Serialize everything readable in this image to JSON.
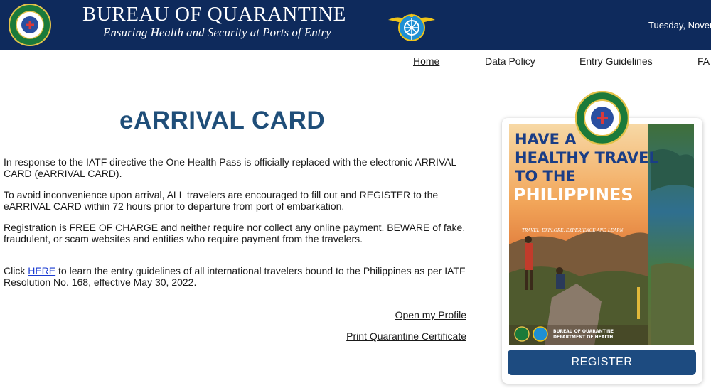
{
  "header": {
    "title": "BUREAU OF QUARANTINE",
    "tagline": "Ensuring Health and Security at Ports of Entry",
    "date": "Tuesday, Novem"
  },
  "nav": {
    "home": "Home",
    "data_policy": "Data Policy",
    "entry_guidelines": "Entry Guidelines",
    "faq": "FA"
  },
  "main": {
    "title": "eARRIVAL CARD",
    "para1": "In response to the IATF directive the One Health Pass is officially replaced with the electronic ARRIVAL CARD (eARRIVAL CARD).",
    "para2": "To avoid inconvenience upon arrival, ALL travelers are encouraged to fill out and REGISTER to the eARRIVAL CARD within 72 hours prior to departure from port of embarkation.",
    "para3": "Registration is FREE OF CHARGE and neither require nor collect any online payment. BEWARE of fake, fraudulent, or scam websites and entities who require payment from the travelers.",
    "para4_prefix": "Click ",
    "para4_link": "HERE",
    "para4_suffix": " to learn the entry guidelines of all international travelers bound to the Philippines as per IATF Resolution No. 168, effective May 30, 2022.",
    "open_profile": "Open my Profile",
    "print_certificate": "Print Quarantine Certificate"
  },
  "poster": {
    "line1": "HAVE A",
    "line2": "HEALTHY TRAVEL",
    "line3": "TO THE",
    "line4": "PHILIPPINES",
    "tagline": "TRAVEL, EXPLORE, EXPERIENCE AND LEARN",
    "org1": "BUREAU OF QUARANTINE",
    "org2": "DEPARTMENT OF HEALTH"
  },
  "register_label": "REGISTER",
  "colors": {
    "header_bg": "#0e2a5c",
    "title_blue": "#1f4e79",
    "button_bg": "#1d4b80",
    "link_blue": "#1a3bd1"
  }
}
